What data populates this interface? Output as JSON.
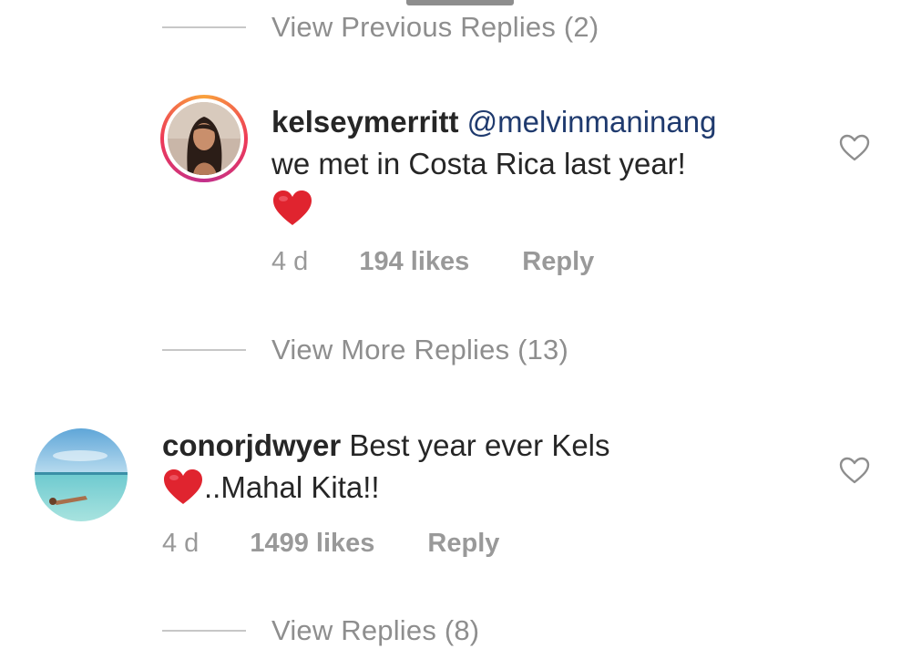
{
  "thread": {
    "view_previous": "View Previous Replies (2)",
    "view_more": "View More Replies (13)",
    "view_replies": "View Replies (8)"
  },
  "comments": [
    {
      "username": "kelseymerritt",
      "mention": "@melvinmaninang",
      "text": "we met in Costa Rica last year!",
      "emoji": "heart-emoji",
      "time": "4 d",
      "likes": "194 likes",
      "reply": "Reply",
      "avatar": "avatar-kelseymerritt",
      "story_ring": true
    },
    {
      "username": "conorjdwyer",
      "text": "Best year ever Kels",
      "text2": "..Mahal Kita!!",
      "emoji": "heart-emoji",
      "time": "4 d",
      "likes": "1499 likes",
      "reply": "Reply",
      "avatar": "avatar-conorjdwyer",
      "story_ring": false
    }
  ],
  "icons": {
    "like": "heart-outline-icon",
    "emoji": "red-heart-emoji"
  },
  "colors": {
    "username": "#262626",
    "mention": "#1f3a6e",
    "muted": "#8e8e8e",
    "heart": "#e0242f"
  }
}
